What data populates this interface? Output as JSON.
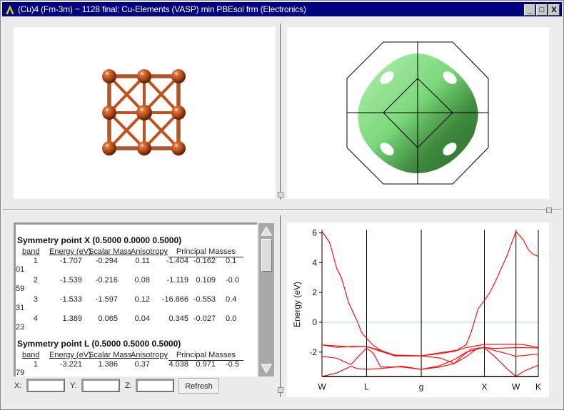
{
  "window": {
    "title": "(Cu)4  (Fm-3m) ~ 1128 final: Cu-Elements (VASP) min PBEsol frm (Electronics)",
    "buttons": {
      "minimize": "_",
      "maximize": "□",
      "close": "X"
    },
    "title_bar_color": "#000080"
  },
  "structure_view": {
    "atom_color": "#b04a18",
    "icon": "cu-fcc-unit-cell"
  },
  "fermi_surface_view": {
    "surface_color": "#5cc85c",
    "icon": "fermi-surface"
  },
  "symmetry_table": {
    "headers": {
      "band": "band",
      "energy": "Energy (eV)",
      "scalar_mass": "Scalar Mass",
      "anisotropy": "Anisotropy",
      "principal_masses": "Principal Masses"
    },
    "sections": [
      {
        "title": "Symmetry point X (0.5000 0.0000 0.5000)",
        "rows": [
          {
            "band": "1",
            "energy": "-1.707",
            "scalar_mass": "-0.294",
            "anisotropy": "0.11",
            "pm1": "-1.404",
            "pm2": "-0.162",
            "pm3": "0.1",
            "wrap": "01"
          },
          {
            "band": "2",
            "energy": "-1.539",
            "scalar_mass": "-0.216",
            "anisotropy": "0.08",
            "pm1": "-1.119",
            "pm2": "0.109",
            "pm3": "-0.0",
            "wrap": "59"
          },
          {
            "band": "3",
            "energy": "-1.533",
            "scalar_mass": "-1.597",
            "anisotropy": "0.12",
            "pm1": "-16.866",
            "pm2": "-0.553",
            "pm3": "0.4",
            "wrap": "31"
          },
          {
            "band": "4",
            "energy": "1.389",
            "scalar_mass": "0.065",
            "anisotropy": "0.04",
            "pm1": "0.345",
            "pm2": "-0.027",
            "pm3": "0.0",
            "wrap": "23"
          }
        ]
      },
      {
        "title": "Symmetry point L (0.5000 0.5000 0.5000)",
        "rows": [
          {
            "band": "1",
            "energy": "-3.221",
            "scalar_mass": "1.386",
            "anisotropy": "0.37",
            "pm1": "4.038",
            "pm2": "0.971",
            "pm3": "-0.5",
            "wrap": "79"
          }
        ]
      }
    ]
  },
  "coords": {
    "x_label": "X:",
    "y_label": "Y:",
    "z_label": "Z:",
    "x_value": "",
    "y_value": "",
    "z_value": "",
    "refresh_label": "Refresh"
  },
  "chart_data": {
    "type": "line",
    "title": "",
    "xlabel": "",
    "ylabel": "Energy (eV)",
    "ylim": [
      -3.65,
      6.2
    ],
    "xlim": [
      0,
      3.427
    ],
    "yticks": [
      6,
      4,
      2,
      0,
      -2
    ],
    "fermi_level": 0,
    "fermi_color": "#a8dcea",
    "band_color": "#ff0000",
    "symmetry_points": [
      {
        "label": "W",
        "k": 0
      },
      {
        "label": "L",
        "k": 0.707
      },
      {
        "label": "g",
        "k": 1.573
      },
      {
        "label": "X",
        "k": 2.573
      },
      {
        "label": "W",
        "k": 3.073
      },
      {
        "label": "K",
        "k": 3.427
      }
    ],
    "series": [
      {
        "points": [
          [
            0,
            -3.64
          ],
          [
            0.233,
            -3.4
          ],
          [
            0.459,
            -2.95
          ],
          [
            0.554,
            -3.1
          ],
          [
            0.707,
            -3.16
          ],
          [
            0.93,
            -3.1
          ],
          [
            1.269,
            -2.95
          ],
          [
            1.573,
            -3.16
          ],
          [
            1.872,
            -3.0
          ],
          [
            2.098,
            -2.76
          ],
          [
            2.286,
            -2.3
          ],
          [
            2.474,
            -1.72
          ],
          [
            2.573,
            -1.72
          ],
          [
            2.738,
            -2.3
          ],
          [
            2.926,
            -3.1
          ],
          [
            3.073,
            -3.64
          ],
          [
            3.19,
            -3.3
          ],
          [
            3.427,
            -2.87
          ]
        ]
      },
      {
        "points": [
          [
            0,
            -2.28
          ],
          [
            0.233,
            -2.41
          ],
          [
            0.459,
            -2.84
          ],
          [
            0.554,
            -2.4
          ],
          [
            0.707,
            -1.72
          ],
          [
            0.817,
            -2.1
          ],
          [
            0.93,
            -3.0
          ],
          [
            1.269,
            -3.0
          ],
          [
            1.573,
            -3.16
          ],
          [
            1.872,
            -2.9
          ],
          [
            2.098,
            -2.5
          ],
          [
            2.286,
            -2.0
          ],
          [
            2.573,
            -1.67
          ],
          [
            2.738,
            -1.9
          ],
          [
            2.926,
            -2.1
          ],
          [
            3.073,
            -2.28
          ],
          [
            3.265,
            -2.2
          ],
          [
            3.427,
            -2.12
          ]
        ]
      },
      {
        "points": [
          [
            0,
            -1.52
          ],
          [
            0.233,
            -1.68
          ],
          [
            0.459,
            -1.62
          ],
          [
            0.707,
            -1.62
          ],
          [
            0.93,
            -1.95
          ],
          [
            1.156,
            -2.25
          ],
          [
            1.573,
            -2.25
          ],
          [
            1.872,
            -2.4
          ],
          [
            2.098,
            -2.76
          ],
          [
            2.211,
            -2.3
          ],
          [
            2.361,
            -1.8
          ],
          [
            2.573,
            -1.7
          ],
          [
            2.738,
            -1.75
          ],
          [
            3.073,
            -1.7
          ],
          [
            3.427,
            -1.72
          ]
        ]
      },
      {
        "points": [
          [
            0,
            -1.52
          ],
          [
            0.459,
            -1.65
          ],
          [
            0.707,
            -1.62
          ],
          [
            0.93,
            -1.9
          ],
          [
            1.156,
            -2.2
          ],
          [
            1.573,
            -2.25
          ],
          [
            1.872,
            -2.1
          ],
          [
            2.098,
            -1.95
          ],
          [
            2.286,
            -1.7
          ],
          [
            2.573,
            -1.48
          ],
          [
            3.073,
            -1.48
          ],
          [
            3.19,
            -1.5
          ],
          [
            3.427,
            -1.69
          ]
        ]
      },
      {
        "points": [
          [
            0,
            6.09
          ],
          [
            0.12,
            5.37
          ],
          [
            0.233,
            3.62
          ],
          [
            0.309,
            2.98
          ],
          [
            0.422,
            1.31
          ],
          [
            0.554,
            0.11
          ],
          [
            0.629,
            -0.69
          ],
          [
            0.707,
            -1.08
          ],
          [
            0.817,
            -1.56
          ],
          [
            0.93,
            -1.88
          ],
          [
            1.156,
            -2.25
          ],
          [
            1.573,
            -2.25
          ],
          [
            1.872,
            -2.04
          ],
          [
            2.135,
            -1.88
          ],
          [
            2.286,
            -1.5
          ],
          [
            2.361,
            -0.69
          ],
          [
            2.418,
            0.11
          ],
          [
            2.474,
            0.91
          ],
          [
            2.573,
            1.47
          ],
          [
            2.663,
            2.03
          ],
          [
            2.738,
            2.66
          ],
          [
            2.926,
            4.42
          ],
          [
            3.073,
            6.09
          ],
          [
            3.19,
            5.53
          ],
          [
            3.265,
            4.9
          ],
          [
            3.34,
            4.58
          ],
          [
            3.427,
            4.42
          ]
        ]
      }
    ]
  }
}
